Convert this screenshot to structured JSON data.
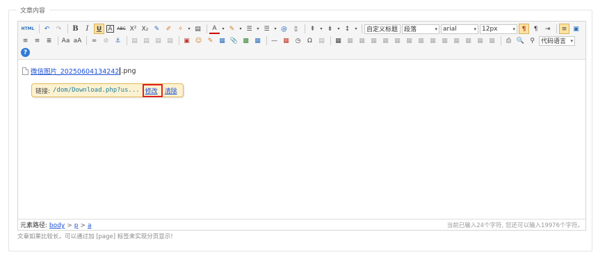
{
  "section_label": "文章内容",
  "toolbar": {
    "html_label": "HTML",
    "bold": "B",
    "italic": "I",
    "underline": "U",
    "strike": "ABC",
    "superscript": "X²",
    "subscript": "X₂",
    "font_color": "A",
    "custom_title": "自定义标题",
    "paragraph": "段落",
    "font_family": "arial",
    "font_size": "12px",
    "code_language": "代码语言"
  },
  "content": {
    "file_name": "微信图片_20250604134242",
    "file_ext": ".png"
  },
  "link_popup": {
    "label": "链接:",
    "url": "/dom/Download.php?us...",
    "edit": "修改",
    "clear": "清除"
  },
  "statusbar": {
    "path_label": "元素路径:",
    "path": [
      "body",
      "p",
      "a"
    ],
    "count_text": "当前已输入24个字符, 您还可以输入19976个字符。"
  },
  "hint": "文章如果比较长，可以通过加 [page] 标签来实现分页显示!"
}
